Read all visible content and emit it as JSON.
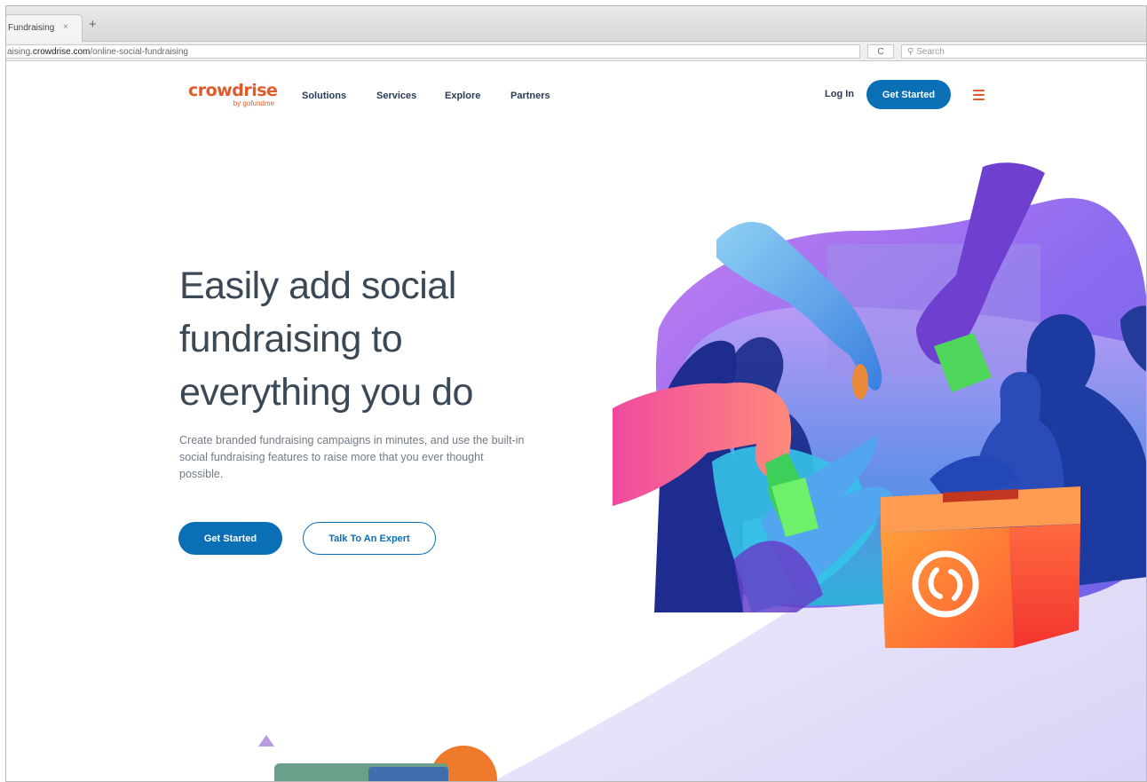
{
  "browser": {
    "tab_title": "Fundraising",
    "tab_close": "×",
    "new_tab": "+",
    "url_prefix": "aising.",
    "url_domain": "crowdrise.com",
    "url_path": "/online-social-fundraising",
    "reload": "C",
    "search_placeholder": "Search"
  },
  "header": {
    "logo_text": "crowdrise",
    "logo_sub": "by gofundme",
    "nav": [
      "Solutions",
      "Services",
      "Explore",
      "Partners"
    ],
    "login": "Log In",
    "get_started": "Get Started"
  },
  "hero": {
    "title": "Easily add social fundraising to everything you do",
    "description": "Create branded fundraising campaigns in minutes, and use the built-in social fundraising features to raise more that you ever thought possible.",
    "primary_cta": "Get Started",
    "secondary_cta": "Talk To An Expert"
  },
  "colors": {
    "brand_orange": "#e15a2b",
    "brand_blue": "#0a6fb5",
    "heading": "#3b4856"
  },
  "icons": {
    "search": "search-icon",
    "reload": "reload-icon",
    "menu": "hamburger-menu-icon",
    "donation_box_logo": "gofundme-logo-icon"
  }
}
